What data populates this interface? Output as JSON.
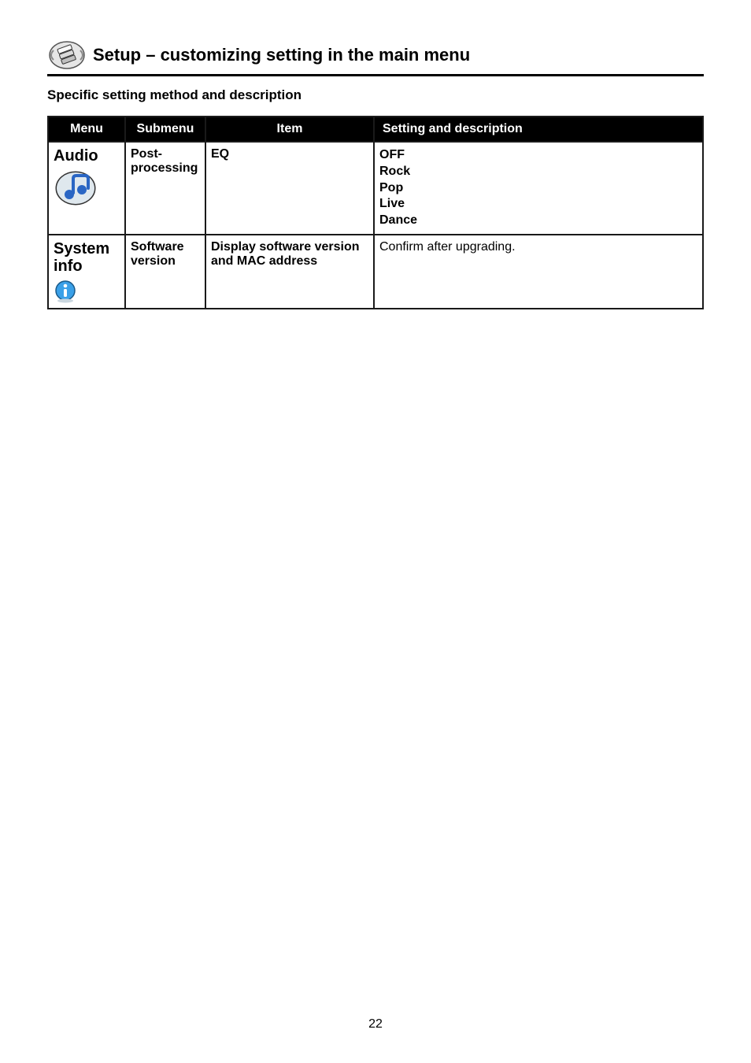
{
  "header": {
    "title": "Setup – customizing setting in the main menu"
  },
  "subtitle": "Specific setting method and description",
  "table": {
    "headers": {
      "menu": "Menu",
      "submenu": "Submenu",
      "item": "Item",
      "desc": "Setting and description"
    },
    "rows": [
      {
        "menu_label": "Audio",
        "submenu": "Post-processing",
        "item": "EQ",
        "desc_lines": [
          "OFF",
          "Rock",
          "Pop",
          "Live",
          "Dance"
        ],
        "desc_bold": true
      },
      {
        "menu_label": "System info",
        "submenu": "Software version",
        "item": "Display software version and MAC address",
        "desc_lines": [
          "Confirm after upgrading."
        ],
        "desc_bold": false
      }
    ]
  },
  "page_number": "22"
}
